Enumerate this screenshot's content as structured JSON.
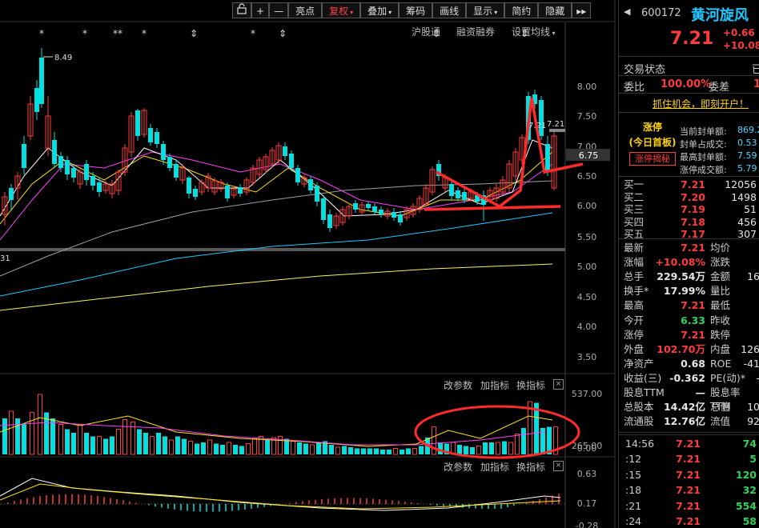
{
  "toolbar": {
    "lock_icon": "lock-icon",
    "plus": "+",
    "minus": "—",
    "items": [
      {
        "label": "亮点",
        "active": false,
        "caret": false
      },
      {
        "label": "复权",
        "active": true,
        "caret": true
      },
      {
        "label": "叠加",
        "active": false,
        "caret": true
      },
      {
        "label": "筹码",
        "active": false,
        "caret": false
      },
      {
        "label": "画线",
        "active": false,
        "caret": false
      },
      {
        "label": "显示",
        "active": false,
        "caret": true
      },
      {
        "label": "简约",
        "active": false,
        "caret": false
      },
      {
        "label": "隐藏",
        "active": false,
        "caret": false
      }
    ],
    "more": "▸▸"
  },
  "info_row": {
    "hgt": "沪股通",
    "margin": "融资融券",
    "ma_setting": "设置均线"
  },
  "price_axis": [
    "8.00",
    "7.50",
    "7.00",
    "6.75",
    "6.50",
    "6.00",
    "5.50",
    "5.00",
    "4.50",
    "4.00",
    "3.50"
  ],
  "annotations": {
    "high": "8.49",
    "left_low": "31",
    "last_price_mark": "7.21",
    "last_price_mark2": "7.21"
  },
  "volume_panel": {
    "btn_params": "改参数",
    "btn_add": "加指标",
    "btn_switch": "换指标",
    "axis": [
      "537.00",
      "265.00",
      "0.00"
    ]
  },
  "macd_panel": {
    "btn_params": "改参数",
    "btn_add": "加指标",
    "btn_switch": "换指标",
    "axis": [
      "0.63",
      "0.17",
      "-0.28"
    ]
  },
  "colors": {
    "up": "#ff3b3b",
    "down": "#00e0e0",
    "ma5": "#ffffff",
    "ma10": "#ffe600",
    "ma20": "#ff40ff",
    "ma60": "#9aa0a8",
    "ma120": "#1ec8ff",
    "ma250": "#f2f26a",
    "annot": "#ff2a2a"
  },
  "quote": {
    "code": "600172",
    "name": "黄河旋风",
    "price": "7.21",
    "change": "+0.66",
    "change_pct": "+10.08%",
    "status_label": "交易状态",
    "status_value": "已",
    "weibi_label": "委比",
    "weibi": "100.00%",
    "weicha_label": "委差",
    "weicha": "1",
    "promo": "抓住机会，即刻开户！",
    "limit_title": "涨停",
    "limit_sub": "(今日首板)",
    "limit_btn": "涨停揭秘",
    "seal_items": [
      {
        "label": "当前封单额:",
        "value": "869.2"
      },
      {
        "label": "封单占成交:",
        "value": "0.53"
      },
      {
        "label": "最高封单额:",
        "value": "7.59"
      },
      {
        "label": "涨停成交额:",
        "value": "5.79"
      }
    ],
    "bids": [
      {
        "label": "买一",
        "price": "7.21",
        "vol": "12056"
      },
      {
        "label": "买二",
        "price": "7.20",
        "vol": "1498"
      },
      {
        "label": "买三",
        "price": "7.19",
        "vol": "51"
      },
      {
        "label": "买四",
        "price": "7.18",
        "vol": "456"
      },
      {
        "label": "买五",
        "price": "7.17",
        "vol": "307"
      }
    ],
    "stats": [
      {
        "l1": "最新",
        "v1": "7.21",
        "c1": "red",
        "l2": "均价",
        "v2": ""
      },
      {
        "l1": "涨幅",
        "v1": "+10.08%",
        "c1": "red",
        "l2": "涨跌",
        "v2": ""
      },
      {
        "l1": "总手",
        "v1": "229.54万",
        "c1": "wht",
        "l2": "金额",
        "v2": "16"
      },
      {
        "l1": "换手*",
        "v1": "17.99%",
        "c1": "wht",
        "l2": "量比",
        "v2": ""
      },
      {
        "l1": "最高",
        "v1": "7.21",
        "c1": "red",
        "l2": "最低",
        "v2": ""
      },
      {
        "l1": "今开",
        "v1": "6.33",
        "c1": "grn",
        "l2": "昨收",
        "v2": ""
      },
      {
        "l1": "涨停",
        "v1": "7.21",
        "c1": "red",
        "l2": "跌停",
        "v2": ""
      },
      {
        "l1": "外盘",
        "v1": "102.70万",
        "c1": "red",
        "l2": "内盘",
        "v2": "126"
      },
      {
        "l1": "净资产",
        "v1": "0.68",
        "c1": "wht",
        "l2": "ROE",
        "v2": "-41"
      },
      {
        "l1": "收益(三)",
        "v1": "-0.362",
        "c1": "wht",
        "l2": "PE(动)*",
        "v2": "-"
      },
      {
        "l1": "股息TTM",
        "v1": "—",
        "c1": "wht",
        "l2": "股息率TTM",
        "v2": ""
      },
      {
        "l1": "总股本",
        "v1": "14.42亿",
        "c1": "wht",
        "l2": "总值",
        "v2": "10"
      },
      {
        "l1": "流通股",
        "v1": "12.76亿",
        "c1": "wht",
        "l2": "流值",
        "v2": "92"
      }
    ],
    "ticks": [
      {
        "time": "14:56",
        "price": "7.21",
        "vol": "74"
      },
      {
        "time": ":12",
        "price": "7.21",
        "vol": "5"
      },
      {
        "time": ":15",
        "price": "7.21",
        "vol": "120"
      },
      {
        "time": ":18",
        "price": "7.21",
        "vol": "32"
      },
      {
        "time": ":21",
        "price": "7.21",
        "vol": "554"
      },
      {
        "time": ":24",
        "price": "7.21",
        "vol": "58"
      }
    ]
  }
}
